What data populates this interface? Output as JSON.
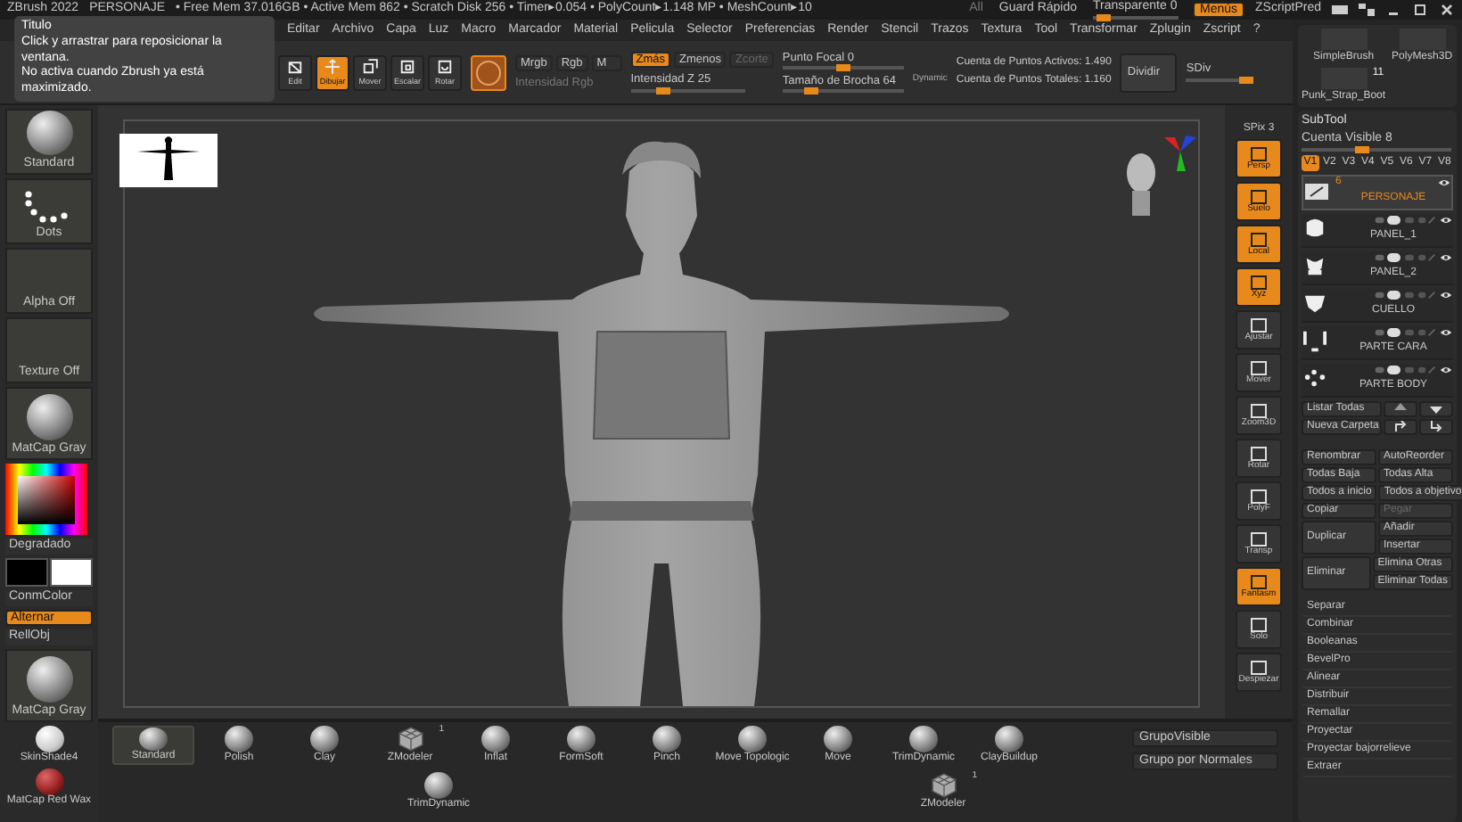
{
  "title_bar": {
    "app": "ZBrush 2022",
    "document": "PERSONAJE",
    "stats": "• Free Mem 37.016GB • Active Mem 862 • Scratch Disk 256 • Timer▸0.054 • PolyCount▸1.148 MP • MeshCount▸10",
    "all": "All",
    "quick_save": "Guard Rápido",
    "transparency": {
      "label": "Transparente 0",
      "level": 0.05
    },
    "menus_button": {
      "label": "Menús",
      "on": true
    },
    "script": "ZScriptPred"
  },
  "menu_bar": [
    "Editar",
    "Archivo",
    "Capa",
    "Luz",
    "Macro",
    "Marcador",
    "Material",
    "Pelicula",
    "Selector",
    "Preferencias",
    "Render",
    "Stencil",
    "Trazos",
    "Textura",
    "Tool",
    "Transformar",
    "Zplugin",
    "Zscript",
    "?"
  ],
  "tooltip": {
    "title": "Titulo",
    "lines": [
      "Click y arrastrar para reposicionar la ventana.",
      "No activa cuando Zbrush ya está maximizado."
    ]
  },
  "shelf": {
    "tools": [
      {
        "label": "Edit",
        "selected": false
      },
      {
        "label": "Dibujar",
        "selected": true
      },
      {
        "label": "Mover",
        "selected": false
      },
      {
        "label": "Escalar",
        "selected": false
      },
      {
        "label": "Rotar",
        "selected": false
      }
    ],
    "color_modes": [
      "Mrgb",
      "Rgb",
      "M"
    ],
    "rgb_intensity": "Intensidad Rgb",
    "z_modes": [
      {
        "label": "Zmás",
        "selected": true,
        "disabled": false
      },
      {
        "label": "Zmenos",
        "selected": false,
        "disabled": false
      },
      {
        "label": "Zcorte",
        "selected": false,
        "disabled": true
      }
    ],
    "z_intensity": {
      "label": "Intensidad Z 25",
      "level": 0.25
    },
    "focal": {
      "label": "Punto Focal 0",
      "level": 0.5
    },
    "brush_size": {
      "label": "Tamaño de Brocha 64",
      "level": 0.2
    },
    "dynamic": "Dynamic",
    "active_points": "Cuenta de Puntos Activos: 1.490",
    "total_points": "Cuenta de Puntos Totales: 1.160",
    "divide": "Dividir",
    "sdiv": {
      "label": "SDiv",
      "level": 1
    }
  },
  "left_panel": {
    "brush": "Standard",
    "stroke": "Dots",
    "alpha": "Alpha Off",
    "texture": "Texture Off",
    "material": "MatCap Gray",
    "gradient": "Degradado",
    "fill_color": "ConmColor",
    "switch": "Alternar",
    "fill_object": "RellObj",
    "material_2": "MatCap Gray",
    "materials": [
      "SkinShade4",
      "MatCap Red Wax"
    ]
  },
  "view_controls": {
    "spix": "SPix 3",
    "buttons": [
      {
        "label": "Persp",
        "on": true
      },
      {
        "label": "Suelo",
        "on": true
      },
      {
        "label": "Local",
        "on": true
      },
      {
        "label": "Xyz",
        "on": true
      },
      {
        "label": "Ajustar",
        "on": false
      },
      {
        "label": "Mover",
        "on": false
      },
      {
        "label": "Zoom3D",
        "on": false
      },
      {
        "label": "Rotar",
        "on": false
      },
      {
        "label": "PolyF",
        "on": false
      },
      {
        "label": "Transp",
        "on": false
      },
      {
        "label": "Fantasm",
        "on": true
      },
      {
        "label": "Solo",
        "on": false
      },
      {
        "label": "Despiezar",
        "on": false
      }
    ]
  },
  "tool_palette": [
    {
      "label": "SimpleBrush"
    },
    {
      "label": "PolyMesh3D"
    },
    {
      "label": "Punk_Strap_Boot",
      "badge": "11"
    }
  ],
  "subtool": {
    "title": "SubTool",
    "visible_count": {
      "label": "Cuenta Visible 8",
      "level": 0.4
    },
    "tabs": [
      {
        "label": "V1",
        "selected": true
      },
      {
        "label": "V2",
        "selected": false
      },
      {
        "label": "V3",
        "selected": false
      },
      {
        "label": "V4",
        "selected": false
      },
      {
        "label": "V5",
        "selected": false
      },
      {
        "label": "V6",
        "selected": false
      },
      {
        "label": "V7",
        "selected": false
      },
      {
        "label": "V8",
        "selected": false
      }
    ],
    "items": [
      {
        "name": "PERSONAJE",
        "count": "6",
        "kind": "folder",
        "selected": true
      },
      {
        "name": "PANEL_1",
        "kind": "mesh",
        "selected": false
      },
      {
        "name": "PANEL_2",
        "kind": "mesh",
        "selected": false
      },
      {
        "name": "CUELLO",
        "kind": "mesh",
        "selected": false
      },
      {
        "name": "PARTE CARA",
        "kind": "mesh",
        "selected": false
      },
      {
        "name": "PARTE BODY",
        "kind": "mesh",
        "selected": false
      }
    ],
    "list_all": "Listar Todas",
    "new_folder": "Nueva Carpeta",
    "button_rows": [
      {
        "left": "Renombrar",
        "right": [
          {
            "label": "AutoReorder",
            "disabled": false
          }
        ]
      },
      {
        "left": "Todas Baja",
        "right": [
          {
            "label": "Todas Alta",
            "disabled": false
          }
        ]
      },
      {
        "left": "Todos a inicio",
        "right": [
          {
            "label": "Todos a objetivo",
            "disabled": false
          }
        ]
      },
      {
        "left": "Copiar",
        "right": [
          {
            "label": "Pegar",
            "disabled": true
          }
        ]
      },
      {
        "left": "Duplicar",
        "right": [
          {
            "label": "Añadir",
            "disabled": false
          },
          {
            "label": "Insertar",
            "disabled": false
          }
        ]
      },
      {
        "left": "Eliminar",
        "right": [
          {
            "label": "Elimina Otras",
            "disabled": false
          },
          {
            "label": "Eliminar Todas",
            "disabled": false
          }
        ]
      }
    ],
    "actions": [
      "Separar",
      "Combinar",
      "Booleanas",
      "BevelPro",
      "Alinear",
      "Distribuir",
      "Remallar",
      "Proyectar",
      "Proyectar bajorrelieve",
      "Extraer"
    ]
  },
  "brushes": [
    {
      "label": "Standard",
      "kind": "sphere",
      "selected": true
    },
    {
      "label": "Polish",
      "kind": "sphere",
      "selected": false
    },
    {
      "label": "Clay",
      "kind": "sphere",
      "selected": false
    },
    {
      "label": "ZModeler",
      "kind": "cube",
      "selected": false,
      "badge": "1"
    },
    {
      "label": "Inflat",
      "kind": "sphere",
      "selected": false
    },
    {
      "label": "FormSoft",
      "kind": "sphere",
      "selected": false
    },
    {
      "label": "Pinch",
      "kind": "sphere",
      "selected": false
    },
    {
      "label": "Move Topologic",
      "kind": "sphere",
      "selected": false
    },
    {
      "label": "Move",
      "kind": "sphere",
      "selected": false
    },
    {
      "label": "TrimDynamic",
      "kind": "sphere",
      "selected": false
    },
    {
      "label": "ClayBuildup",
      "kind": "sphere",
      "selected": false
    }
  ],
  "brushes_row2": [
    {
      "label": "TrimDynamic",
      "kind": "sphere"
    },
    {
      "label": "ZModeler",
      "kind": "cube",
      "badge": "1"
    }
  ],
  "groups": [
    "GrupoVisible",
    "Grupo por Normales"
  ]
}
